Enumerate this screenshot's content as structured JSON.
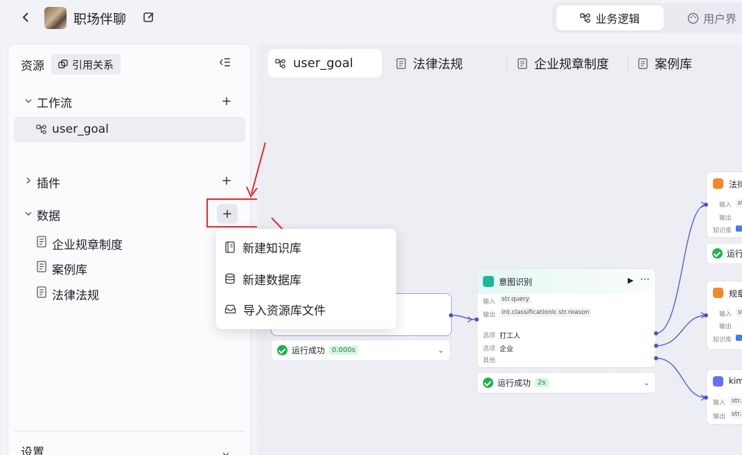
{
  "header": {
    "app_title": "职场伴聊",
    "view_tabs": [
      "业务逻辑",
      "用户界"
    ]
  },
  "sidebar": {
    "resources_label": "资源",
    "references_label": "引用关系",
    "sections": {
      "workflow": {
        "label": "工作流",
        "items": [
          "user_goal"
        ]
      },
      "plugin": {
        "label": "插件"
      },
      "data": {
        "label": "数据",
        "items": [
          "企业规章制度",
          "案例库",
          "法律法规"
        ]
      }
    },
    "settings_label": "设置"
  },
  "dropdown_menu": {
    "items": [
      "新建知识库",
      "新建数据库",
      "导入资源库文件"
    ]
  },
  "canvas": {
    "tabs": [
      "user_goal",
      "法律法规",
      "企业规章制度",
      "案例库"
    ],
    "start_status": {
      "text": "运行成功",
      "time": "0.000s"
    },
    "intent_node": {
      "title": "意图识别",
      "input_label": "输入",
      "output_label": "输出",
      "input_tag": "str.query",
      "output_tags": [
        "int.classificationId",
        "str.reason"
      ],
      "option_label": "选项",
      "options": [
        "打工人",
        "企业"
      ],
      "other_label": "其他",
      "status": {
        "text": "运行成功",
        "time": "2s"
      }
    },
    "right_nodes": {
      "law_title": "法律",
      "law_status": "运行",
      "rule_title": "规章",
      "kimi_title": "kim",
      "row_labels": {
        "input": "输入",
        "output": "输出",
        "kb": "知识库"
      },
      "tags": {
        "str": "str",
        "str_a": "str.a",
        "str_n": "str.n"
      }
    }
  },
  "colors": {
    "accent": "#4b50d8",
    "success": "#22b14c",
    "annotation_red": "#e8262a"
  }
}
